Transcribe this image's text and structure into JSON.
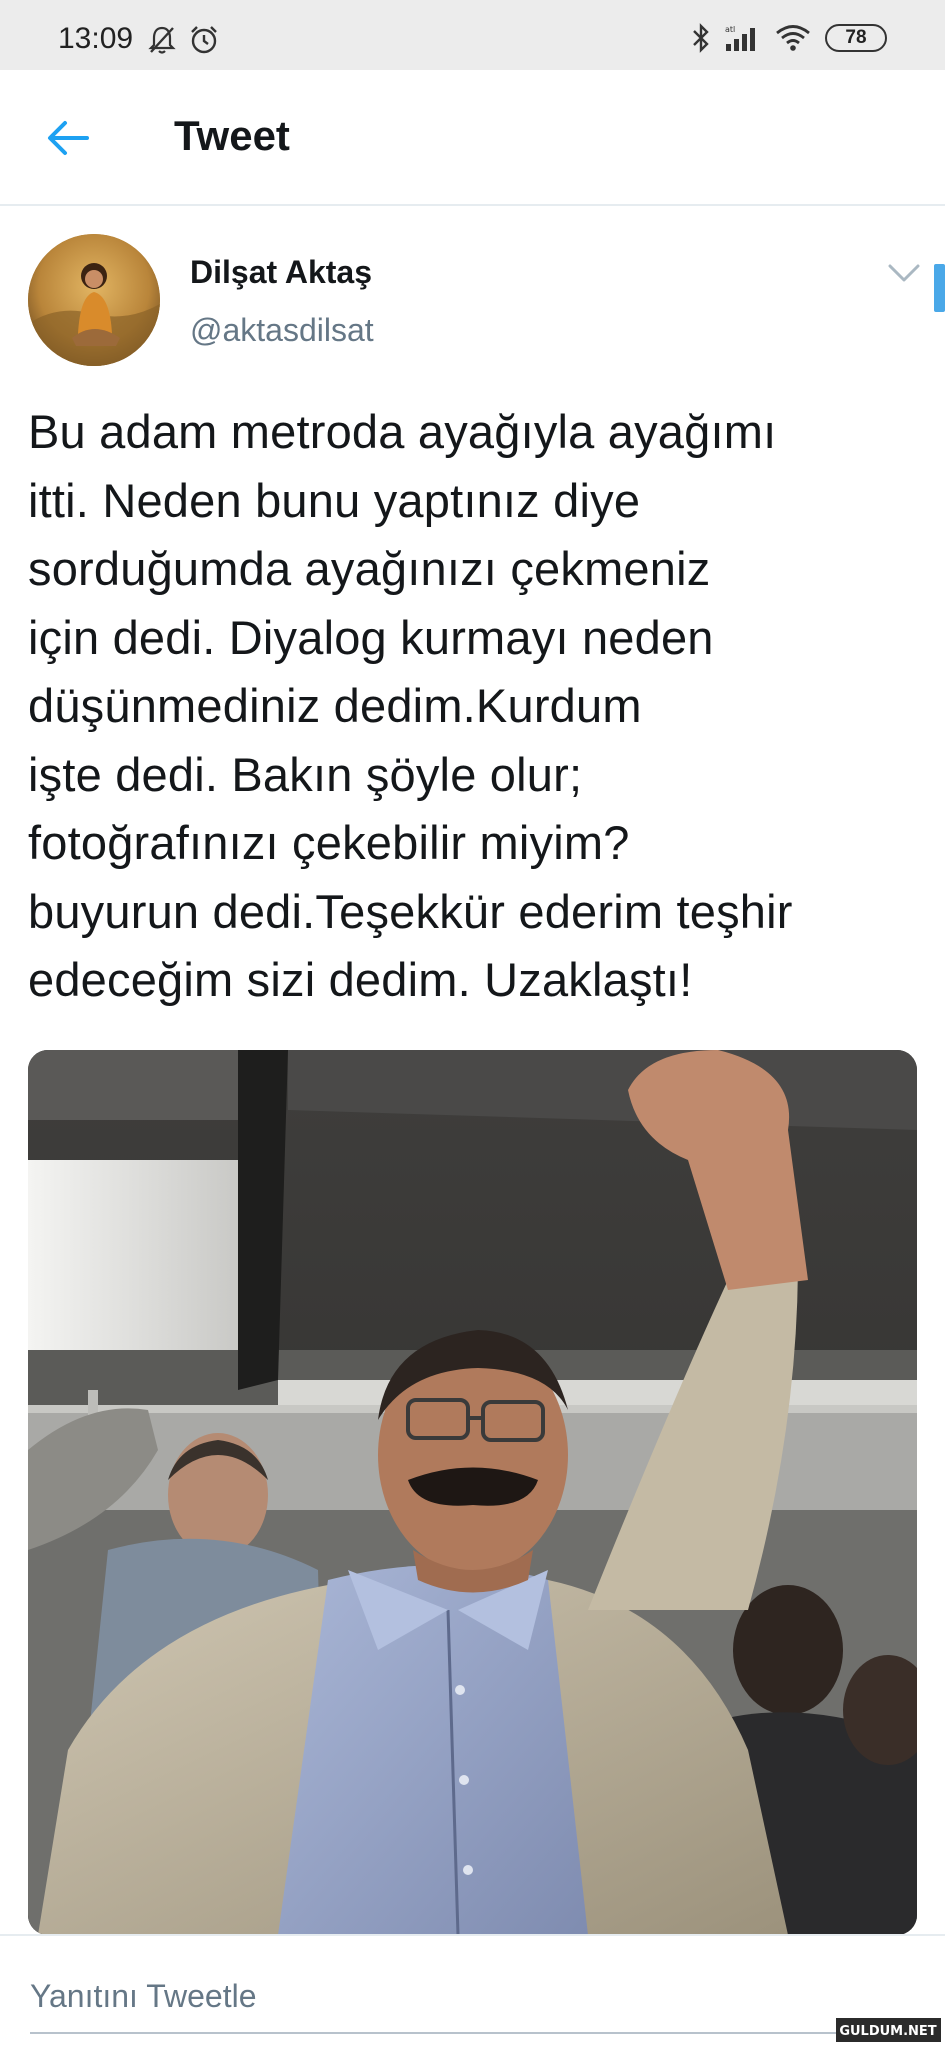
{
  "status_bar": {
    "time": "13:09",
    "battery": "78"
  },
  "header": {
    "title": "Tweet"
  },
  "tweet": {
    "author_name": "Dilşat Aktaş",
    "author_handle": "@aktasdilsat",
    "text": "Bu adam metroda ayağıyla ayağımı\nitti. Neden bunu yaptınız diye\nsorduğumda ayağınızı çekmeniz\niçin dedi. Diyalog kurmayı neden\ndüşünmediniz dedim.Kurdum\nişte dedi. Bakın şöyle olur;\nfotoğrafınızı çekebilir miyim?\nbuyurun dedi.Teşekkür ederim teşhir\nedeceğim sizi dedim. Uzaklaştı!"
  },
  "reply": {
    "placeholder": "Yanıtını Tweetle"
  },
  "watermark": {
    "text": "GULDUM.NET"
  },
  "icons": {
    "back": "arrow-left-icon",
    "caret": "chevron-down-icon",
    "mute": "bell-off-icon",
    "alarm": "alarm-icon",
    "bluetooth": "bluetooth-icon",
    "signal": "signal-icon",
    "wifi": "wifi-icon"
  },
  "colors": {
    "accent": "#1da1f2",
    "secondary_text": "#657786",
    "divider": "#e6ecf0"
  }
}
